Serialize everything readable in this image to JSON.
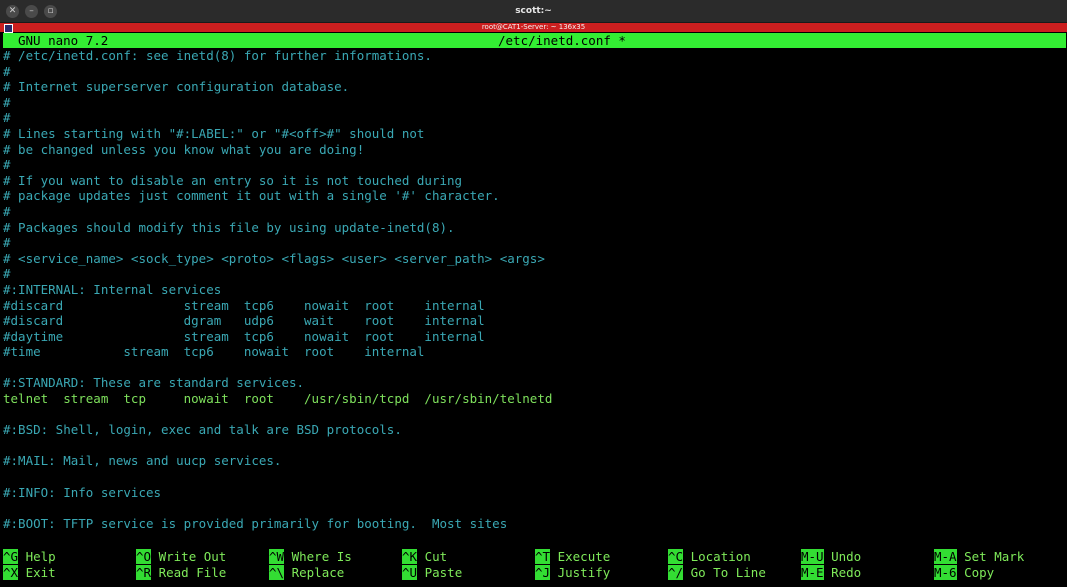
{
  "window": {
    "title": "scott:~",
    "buttons": {
      "close": "✕",
      "minimize": "–",
      "maximize": "▫"
    }
  },
  "terminal": {
    "title": "root@CAT1-Server: ~ 136x35"
  },
  "nano": {
    "version": "GNU nano 7.2",
    "filename": "/etc/inetd.conf *"
  },
  "editor": {
    "lines": [
      "# /etc/inetd.conf: see inetd(8) for further informations.",
      "#",
      "# Internet superserver configuration database.",
      "#",
      "#",
      "# Lines starting with \"#:LABEL:\" or \"#<off>#\" should not",
      "# be changed unless you know what you are doing!",
      "#",
      "# If you want to disable an entry so it is not touched during",
      "# package updates just comment it out with a single '#' character.",
      "#",
      "# Packages should modify this file by using update-inetd(8).",
      "#",
      "# <service_name> <sock_type> <proto> <flags> <user> <server_path> <args>",
      "#",
      "#:INTERNAL: Internal services",
      "#discard                stream  tcp6    nowait  root    internal",
      "#discard                dgram   udp6    wait    root    internal",
      "#daytime                stream  tcp6    nowait  root    internal",
      "#time           stream  tcp6    nowait  root    internal",
      "",
      "#:STANDARD: These are standard services.",
      "telnet  stream  tcp     nowait  root    /usr/sbin/tcpd  /usr/sbin/telnetd",
      "",
      "#:BSD: Shell, login, exec and talk are BSD protocols.",
      "",
      "#:MAIL: Mail, news and uucp services.",
      "",
      "#:INFO: Info services",
      "",
      "#:BOOT: TFTP service is provided primarily for booting.  Most sites"
    ]
  },
  "shortcuts": [
    {
      "key": "^G",
      "label": "Help"
    },
    {
      "key": "^O",
      "label": "Write Out"
    },
    {
      "key": "^W",
      "label": "Where Is"
    },
    {
      "key": "^K",
      "label": "Cut"
    },
    {
      "key": "^T",
      "label": "Execute"
    },
    {
      "key": "^C",
      "label": "Location"
    },
    {
      "key": "M-U",
      "label": "Undo"
    },
    {
      "key": "M-A",
      "label": "Set Mark"
    },
    {
      "key": "^X",
      "label": "Exit"
    },
    {
      "key": "^R",
      "label": "Read File"
    },
    {
      "key": "^\\",
      "label": "Replace"
    },
    {
      "key": "^U",
      "label": "Paste"
    },
    {
      "key": "^J",
      "label": "Justify"
    },
    {
      "key": "^/",
      "label": "Go To Line"
    },
    {
      "key": "M-E",
      "label": "Redo"
    },
    {
      "key": "M-6",
      "label": "Copy"
    }
  ],
  "colors": {
    "header_bg": "#33ee33",
    "comment_text": "#3aa8b4",
    "active_text": "#7ee05c",
    "terminal_bar": "#cc1f1f"
  }
}
